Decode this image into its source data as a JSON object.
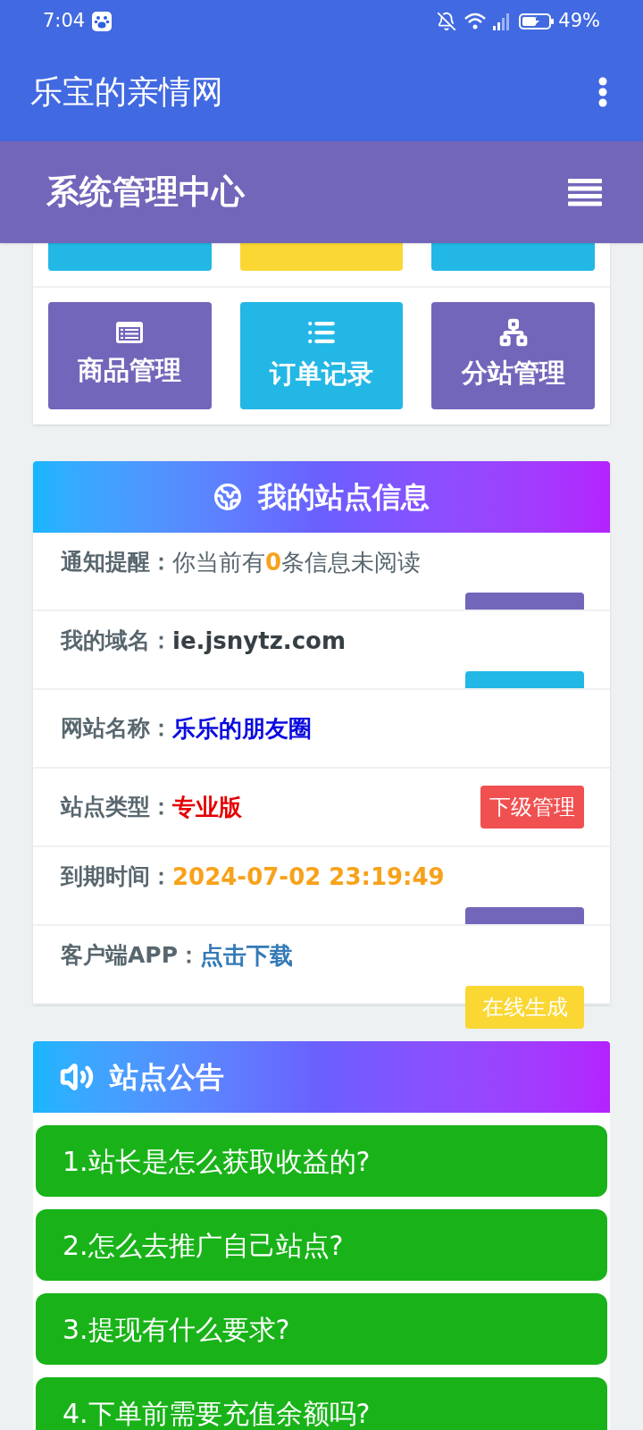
{
  "status_bar": {
    "time": "7:04",
    "battery": "49%"
  },
  "app_bar": {
    "title": "乐宝的亲情网"
  },
  "header": {
    "title": "系统管理中心"
  },
  "shortcuts_cut": [
    {
      "color": "#23b7e5"
    },
    {
      "color": "#fad733"
    },
    {
      "color": "#23b7e5"
    }
  ],
  "shortcuts": [
    {
      "label": "商品管理",
      "kind": "card",
      "color": "#7266ba"
    },
    {
      "label": "订单记录",
      "kind": "list",
      "color": "#23b7e5"
    },
    {
      "label": "分站管理",
      "kind": "sitemap",
      "color": "#7266ba"
    }
  ],
  "site_info": {
    "title": "我的站点信息",
    "rows": [
      {
        "label": "通知提醒：",
        "value": [
          {
            "text": "你当前有",
            "color": "#58666e",
            "bold": false
          },
          {
            "text": "0",
            "color": "#f7a21b",
            "bold": true
          },
          {
            "text": "条信息未阅读",
            "color": "#58666e",
            "bold": false
          }
        ],
        "button": {
          "kind": "below",
          "color": "#7266ba"
        }
      },
      {
        "label": "我的域名：",
        "value": [
          {
            "text": "ie.jsnytz.com",
            "color": "#363f44",
            "bold": true
          }
        ],
        "button": {
          "kind": "below",
          "color": "#23b7e5"
        }
      },
      {
        "label": "网站名称：",
        "value": [
          {
            "text": "乐乐的朋友圈",
            "color": "#0a0ae0",
            "bold": true
          }
        ]
      },
      {
        "label": "站点类型：",
        "value": [
          {
            "text": "专业版",
            "color": "#e60000",
            "bold": true
          }
        ],
        "button": {
          "kind": "inline",
          "color": "#f05050",
          "label": "下级管理"
        }
      },
      {
        "label": "到期时间：",
        "value": [
          {
            "text": "2024-07-02 23:19:49",
            "color": "#f7a21b",
            "bold": true
          }
        ],
        "button": {
          "kind": "below",
          "color": "#7266ba"
        }
      },
      {
        "label": "客户端APP：",
        "value": [
          {
            "text": "点击下载",
            "color": "#337ab7",
            "bold": true
          }
        ],
        "button": {
          "kind": "below",
          "color": "#fad733",
          "label": "在线生成"
        }
      }
    ]
  },
  "notices": {
    "title": "站点公告",
    "items": [
      "1.站长是怎么获取收益的?",
      "2.怎么去推广自己站点?",
      "3.提现有什么要求?",
      "4.下单前需要充值余额吗?"
    ]
  }
}
